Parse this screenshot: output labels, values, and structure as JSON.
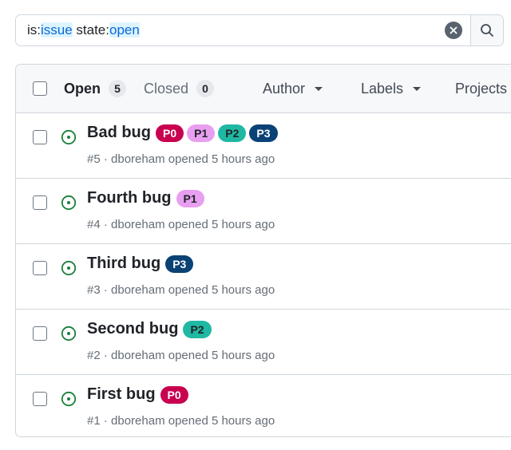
{
  "search": {
    "prefix1": "is:",
    "value1": "issue",
    "prefix2": " state:",
    "value2": "open"
  },
  "tabs": {
    "open_label": "Open",
    "open_count": "5",
    "closed_label": "Closed",
    "closed_count": "0"
  },
  "filters": [
    "Author",
    "Labels",
    "Projects"
  ],
  "label_colors": {
    "P0": {
      "bg": "#c8004f",
      "fg": "#ffffff"
    },
    "P1": {
      "bg": "#e89ff0",
      "fg": "#1f2328"
    },
    "P2": {
      "bg": "#1fb8a2",
      "fg": "#1f2328"
    },
    "P3": {
      "bg": "#0b4275",
      "fg": "#ffffff"
    }
  },
  "accent_open": "#1a7f37",
  "issues": [
    {
      "title": "Bad bug",
      "labels": [
        "P0",
        "P1",
        "P2",
        "P3"
      ],
      "meta": "#5 · dboreham opened 5 hours ago"
    },
    {
      "title": "Fourth bug",
      "labels": [
        "P1"
      ],
      "meta": "#4 · dboreham opened 5 hours ago"
    },
    {
      "title": "Third bug",
      "labels": [
        "P3"
      ],
      "meta": "#3 · dboreham opened 5 hours ago"
    },
    {
      "title": "Second bug",
      "labels": [
        "P2"
      ],
      "meta": "#2 · dboreham opened 5 hours ago"
    },
    {
      "title": "First bug",
      "labels": [
        "P0"
      ],
      "meta": "#1 · dboreham opened 5 hours ago"
    }
  ]
}
